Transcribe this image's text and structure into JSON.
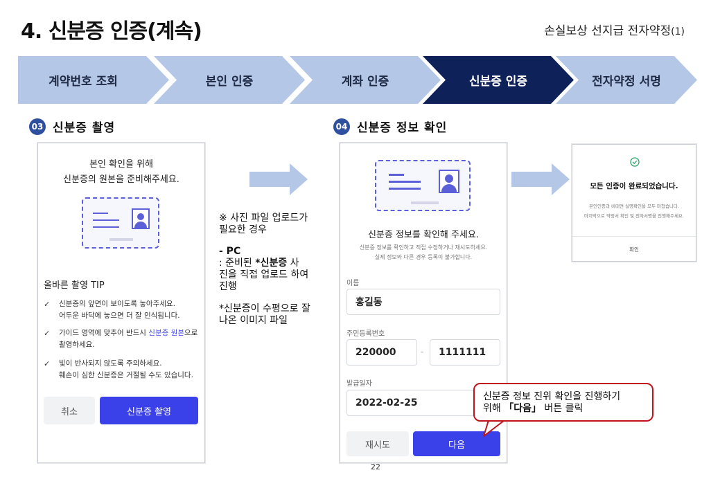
{
  "header": {
    "title": "4. 신분증 인증(계속)",
    "subtitle_main": "손실보상 선지급 전자약정",
    "subtitle_suffix": "(1)"
  },
  "steps": [
    {
      "label": "계약번호 조회",
      "active": false
    },
    {
      "label": "본인 인증",
      "active": false
    },
    {
      "label": "계좌 인증",
      "active": false
    },
    {
      "label": "신분증 인증",
      "active": true
    },
    {
      "label": "전자약정 서명",
      "active": false
    }
  ],
  "colors": {
    "step_inactive": "#b4c7e7",
    "step_active": "#0e2158",
    "badge": "#2f4f9f",
    "primary_button": "#3a41e8",
    "callout_border": "#c0141c"
  },
  "section3": {
    "badge": "03",
    "title": "신분증 촬영",
    "intro_line1": "본인 확인을 위해",
    "intro_line2": "신분증의 원본을 준비해주세요.",
    "tip_title": "올바른 촬영 TIP",
    "tips": [
      {
        "line1": "신분증의 앞면이 보이도록 놓아주세요.",
        "line2": "어두운 바닥에 놓으면 더 잘 인식됩니다."
      },
      {
        "line1_a": "가이드 영역에 맞추어 반드시 ",
        "line1_highlight": "신분증 원본",
        "line1_b": "으로",
        "line2": "촬영하세요."
      },
      {
        "line1": "빛이 반사되지 않도록 주의하세요.",
        "line2": "훼손이 심한 신분증은 거절될 수도 있습니다."
      }
    ],
    "cancel_button": "취소",
    "capture_button": "신분증 촬영"
  },
  "note": {
    "line1": "※ 사진 파일 업로드가",
    "line2": "필요한 경우",
    "pc_label": "- PC",
    "pc_line1_a": " : 준비된 ",
    "pc_line1_bold": "*신분증",
    "pc_line1_b": " 사",
    "pc_line2": "진을 직접 업로드 하여",
    "pc_line3": "진행",
    "footnote_line1": "*신분증이 수평으로 잘",
    "footnote_line2": "나온 이미지 파일"
  },
  "section4": {
    "badge": "04",
    "title": "신분증 정보 확인",
    "heading": "신분증 정보를 확인해 주세요.",
    "desc_line1": "신분증 정보를 확인하고 직접 수정하거나 재시도하세요.",
    "desc_line2": "실제 정보와 다른 경우 등록이 불가합니다.",
    "name_label": "이름",
    "name_value": "홍길동",
    "rrn_label": "주민등록번호",
    "rrn_front": "220000",
    "rrn_dash": "-",
    "rrn_back": "1111111",
    "issue_label": "발급일자",
    "issue_value": "2022-02-25",
    "retry_button": "재시도",
    "next_button": "다음"
  },
  "completion": {
    "title": "모든 인증이 완료되었습니다.",
    "desc_line1": "본인인증과 비대면 실명확인을 모두 마쳤습니다.",
    "desc_line2": "마지막으로 약정서 확인 및 전자서명을 진행해주세요.",
    "confirm_button": "확인"
  },
  "callout": {
    "line1": "신분증 정보 진위 확인을 진행하기",
    "line2_a": "위해 ",
    "line2_bold": "「다음」",
    "line2_b": " 버튼 클릭"
  },
  "page_number": "22"
}
